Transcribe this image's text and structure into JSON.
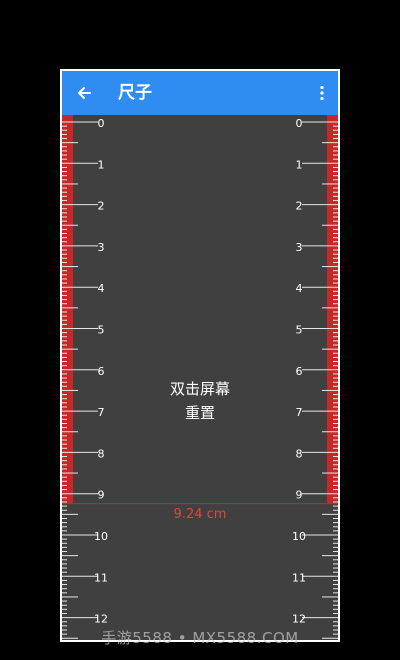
{
  "app": {
    "title": "尺子",
    "back_icon": "arrow-left-icon",
    "menu_icon": "more-vert-icon",
    "appbar_color": "#2f8cf0"
  },
  "ruler": {
    "unit": "cm",
    "left_labels": [
      "0",
      "1",
      "2",
      "3",
      "4",
      "5",
      "6",
      "7",
      "8",
      "9",
      "10",
      "11",
      "12"
    ],
    "right_labels": [
      "0",
      "1",
      "2",
      "3",
      "4",
      "5",
      "6",
      "7",
      "8",
      "9",
      "10",
      "11",
      "12"
    ],
    "highlight_color": "#c62828",
    "measurement_cm": 9.24
  },
  "measurement_text": "9.24 cm",
  "hint": {
    "line1": "双击屏幕",
    "line2": "重置"
  },
  "watermark": "手游5588 • MX5588.COM"
}
